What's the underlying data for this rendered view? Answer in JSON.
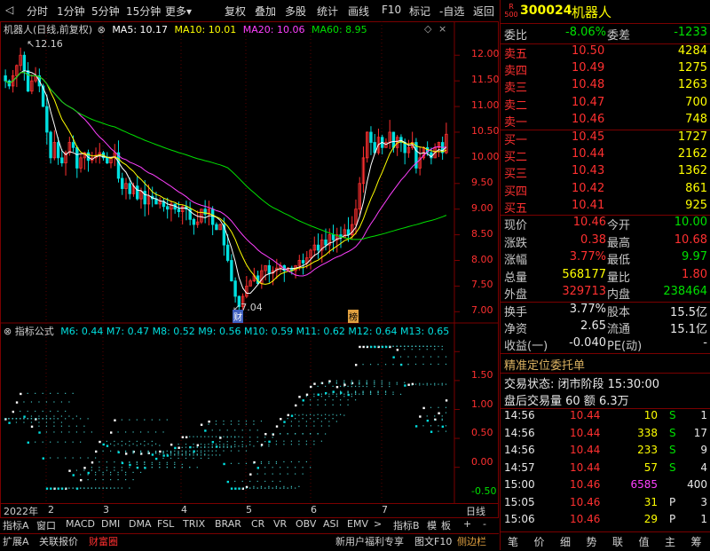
{
  "toolbar": {
    "left_items": [
      "分时",
      "1分钟",
      "5分钟",
      "15分钟",
      "更多"
    ],
    "right_items": [
      "复权",
      "叠加",
      "多股",
      "统计",
      "画线",
      "F10",
      "标记",
      "-自选",
      "返回"
    ]
  },
  "stock": {
    "code": "300024",
    "name": "机器人",
    "badge_top": "R",
    "badge_bottom": "500"
  },
  "main_chart": {
    "title": "机器人(日线,前复权)",
    "ma_labels": [
      {
        "text": "MA5: 10.17",
        "color": "#ffffff"
      },
      {
        "text": "MA10: 10.01",
        "color": "#ffff00"
      },
      {
        "text": "MA20: 10.06",
        "color": "#ff40ff"
      },
      {
        "text": "MA60: 8.95",
        "color": "#00e000"
      }
    ],
    "y_ticks": [
      "12.00",
      "11.50",
      "11.00",
      "10.50",
      "10.00",
      "9.50",
      "9.00",
      "8.50",
      "8.00",
      "7.50",
      "7.00"
    ],
    "high_label": "12.16",
    "low_label": "7.04",
    "marker_cai": "财",
    "marker_bang": "榜"
  },
  "sub_chart": {
    "title": "指标公式",
    "labels": [
      {
        "text": "M6: 0.44"
      },
      {
        "text": "M7: 0.47"
      },
      {
        "text": "M8: 0.52"
      },
      {
        "text": "M9: 0.56"
      },
      {
        "text": "M10: 0.59"
      },
      {
        "text": "M11: 0.62"
      },
      {
        "text": "M12: 0.64"
      },
      {
        "text": "M13: 0.65"
      }
    ],
    "y_ticks": [
      "1.50",
      "1.00",
      "0.50",
      "0.00",
      "-0.50"
    ]
  },
  "x_axis": {
    "labels": [
      "2022年",
      "2",
      "3",
      "4",
      "5",
      "6",
      "7"
    ],
    "period": "日线"
  },
  "bottom_tabs": {
    "row1": [
      "指标A",
      "窗口",
      "MACD",
      "DMI",
      "DMA",
      "FSL",
      "TRIX",
      "BRAR",
      "CR",
      "VR",
      "OBV",
      "ASI",
      "EMV"
    ],
    "row1_right": [
      "指标B",
      "模",
      "板",
      "+",
      "-"
    ],
    "row2": [
      "扩展A",
      "关联报价",
      "财富圈"
    ],
    "row2_right": [
      "新用户福利专享",
      "图文F10",
      "侧边栏"
    ]
  },
  "quote": {
    "weibi_label": "委比",
    "weibi": "-8.06%",
    "weicha_label": "委差",
    "weicha": "-1233",
    "asks": [
      {
        "label": "卖五",
        "price": "10.50",
        "vol": "4284"
      },
      {
        "label": "卖四",
        "price": "10.49",
        "vol": "1275"
      },
      {
        "label": "卖三",
        "price": "10.48",
        "vol": "1263"
      },
      {
        "label": "卖二",
        "price": "10.47",
        "vol": "700"
      },
      {
        "label": "卖一",
        "price": "10.46",
        "vol": "748"
      }
    ],
    "bids": [
      {
        "label": "买一",
        "price": "10.45",
        "vol": "1727"
      },
      {
        "label": "买二",
        "price": "10.44",
        "vol": "2162"
      },
      {
        "label": "买三",
        "price": "10.43",
        "vol": "1362"
      },
      {
        "label": "买四",
        "price": "10.42",
        "vol": "861"
      },
      {
        "label": "买五",
        "price": "10.41",
        "vol": "925"
      }
    ],
    "stats": [
      {
        "l1": "现价",
        "v1": "10.46",
        "c1": "red",
        "l2": "今开",
        "v2": "10.00",
        "c2": "grn"
      },
      {
        "l1": "涨跌",
        "v1": "0.38",
        "c1": "red",
        "l2": "最高",
        "v2": "10.68",
        "c2": "red"
      },
      {
        "l1": "涨幅",
        "v1": "3.77%",
        "c1": "red",
        "l2": "最低",
        "v2": "9.97",
        "c2": "grn"
      },
      {
        "l1": "总量",
        "v1": "568177",
        "c1": "yel",
        "l2": "量比",
        "v2": "1.80",
        "c2": "red"
      },
      {
        "l1": "外盘",
        "v1": "329713",
        "c1": "red",
        "l2": "内盘",
        "v2": "238464",
        "c2": "grn"
      }
    ],
    "stats2": [
      {
        "l1": "换手",
        "v1": "3.77%",
        "l2": "股本",
        "v2": "15.5亿"
      },
      {
        "l1": "净资",
        "v1": "2.65",
        "l2": "流通",
        "v2": "15.1亿"
      },
      {
        "l1": "收益(一)",
        "v1": "-0.040",
        "l2": "PE(动)",
        "v2": "-"
      }
    ],
    "precise_title": "精准定位委托单",
    "trade_status": "交易状态: 闭市阶段 15:30:00",
    "after_hours": "盘后交易量 60 额 6.3万",
    "ticks": [
      {
        "t": "14:56",
        "p": "10.44",
        "v": "10",
        "s": "S",
        "n": "1",
        "vc": "yel"
      },
      {
        "t": "14:56",
        "p": "10.44",
        "v": "338",
        "s": "S",
        "n": "17",
        "vc": "yel"
      },
      {
        "t": "14:56",
        "p": "10.44",
        "v": "233",
        "s": "S",
        "n": "9",
        "vc": "yel"
      },
      {
        "t": "14:57",
        "p": "10.44",
        "v": "57",
        "s": "S",
        "n": "4",
        "vc": "yel"
      },
      {
        "t": "15:00",
        "p": "10.46",
        "v": "6585",
        "s": "",
        "n": "400",
        "vc": "mag"
      },
      {
        "t": "15:05",
        "p": "10.46",
        "v": "31",
        "s": "P",
        "n": "3",
        "vc": "yel"
      },
      {
        "t": "15:06",
        "p": "10.46",
        "v": "29",
        "s": "P",
        "n": "1",
        "vc": "yel"
      }
    ],
    "side_tabs": [
      "笔",
      "价",
      "细",
      "势",
      "联",
      "值",
      "主",
      "筹"
    ]
  },
  "colors": {
    "up": "#ff3030",
    "down": "#00e0e0",
    "grid": "#7a0000"
  }
}
